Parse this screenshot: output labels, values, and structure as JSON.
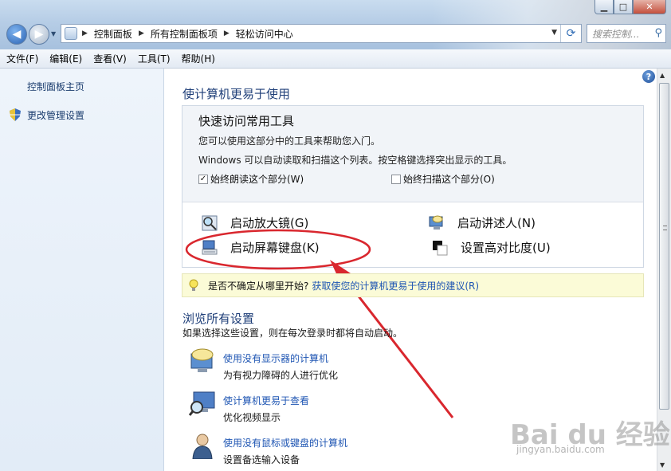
{
  "window": {
    "minimize_glyph": "▁",
    "maximize_glyph": "□",
    "close_glyph": "✕"
  },
  "address": {
    "breadcrumbs": [
      "控制面板",
      "所有控制面板项",
      "轻松访问中心"
    ],
    "search_placeholder": "搜索控制..."
  },
  "menu": [
    "文件(F)",
    "编辑(E)",
    "查看(V)",
    "工具(T)",
    "帮助(H)"
  ],
  "sidebar": {
    "items": [
      {
        "label": "控制面板主页"
      },
      {
        "label": "更改管理设置",
        "icon": "shield-icon"
      }
    ]
  },
  "main": {
    "title": "使计算机更易于使用",
    "quick_access": {
      "title": "快速访问常用工具",
      "desc1": "您可以使用这部分中的工具来帮助您入门。",
      "desc2": "Windows 可以自动读取和扫描这个列表。按空格键选择突出显示的工具。",
      "checkbox_read": {
        "label": "始终朗读这个部分(W)",
        "checked": true
      },
      "checkbox_scan": {
        "label": "始终扫描这个部分(O)",
        "checked": false
      }
    },
    "tools": [
      {
        "label": "启动放大镜(G)",
        "icon": "magnifier-icon"
      },
      {
        "label": "启动讲述人(N)",
        "icon": "narrator-icon"
      },
      {
        "label": "启动屏幕键盘(K)",
        "icon": "on-screen-keyboard-icon"
      },
      {
        "label": "设置高对比度(U)",
        "icon": "high-contrast-icon"
      }
    ],
    "tip": {
      "text": "是否不确定从哪里开始?",
      "link": "获取使您的计算机更易于使用的建议(R)"
    },
    "browse": {
      "title": "浏览所有设置",
      "desc": "如果选择这些设置，则在每次登录时都将自动启动。",
      "items": [
        {
          "link": "使用没有显示器的计算机",
          "desc": "为有视力障碍的人进行优化",
          "icon": "speech-monitor-icon"
        },
        {
          "link": "使计算机更易于查看",
          "desc": "优化视频显示",
          "icon": "monitor-magnifier-icon"
        },
        {
          "link": "使用没有鼠标或键盘的计算机",
          "desc": "设置备选输入设备",
          "icon": "user-icon"
        }
      ]
    }
  },
  "watermark": {
    "main": "Bai du 经验",
    "sub": "jingyan.baidu.com"
  },
  "colors": {
    "link": "#1f56b3",
    "heading": "#1e3e78",
    "annotation": "#d9272e"
  }
}
